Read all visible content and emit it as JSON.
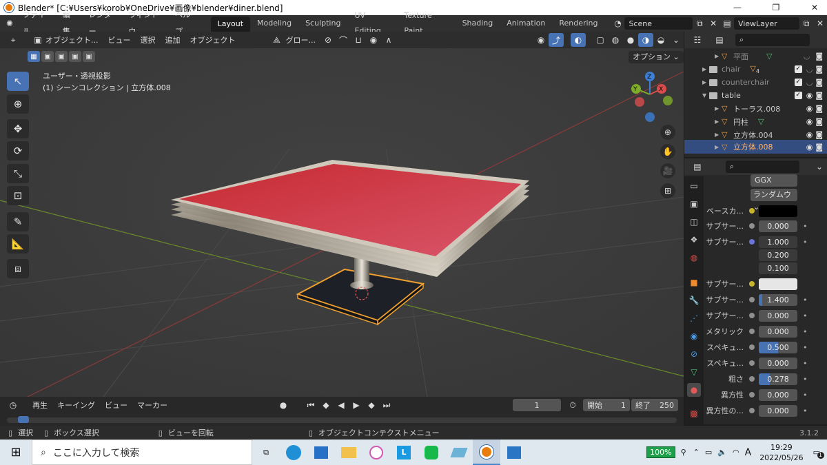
{
  "window": {
    "title": "Blender* [C:¥Users¥korob¥OneDrive¥画像¥blender¥diner.blend]"
  },
  "menubar": {
    "items": [
      "ファイル",
      "編集",
      "レンダー",
      "ウィンドウ",
      "ヘルプ"
    ],
    "workspaces": [
      "Layout",
      "Modeling",
      "Sculpting",
      "UV Editing",
      "Texture Paint",
      "Shading",
      "Animation",
      "Rendering"
    ],
    "active_workspace": "Layout",
    "scene": "Scene",
    "viewlayer": "ViewLayer"
  },
  "viewport": {
    "mode": "オブジェクト...",
    "menus": [
      "ビュー",
      "選択",
      "追加",
      "オブジェクト"
    ],
    "transform_orientation": "グロー...",
    "info_line1": "ユーザー・透視投影",
    "info_line2": "(1) シーンコレクション | 立方体.008",
    "options_label": "オプション",
    "gizmo": {
      "x": "X",
      "y": "Y",
      "z": "Z"
    }
  },
  "outliner": {
    "rows": [
      {
        "name": "平面",
        "kind": "object",
        "icon": "mesh-data-icon",
        "dim": true,
        "expanded": false
      },
      {
        "name": "chair",
        "kind": "collection",
        "badge": "4",
        "dim": true
      },
      {
        "name": "counterchair",
        "kind": "collection",
        "dim": true
      },
      {
        "name": "table",
        "kind": "collection",
        "dim": false
      },
      {
        "name": "トーラス.008",
        "kind": "object"
      },
      {
        "name": "円柱",
        "kind": "object"
      },
      {
        "name": "立方体.004",
        "kind": "object"
      },
      {
        "name": "立方体.008",
        "kind": "object",
        "selected": true
      }
    ]
  },
  "properties": {
    "dropdown1": "GGX",
    "dropdown2": "ランダムウ",
    "rows": [
      {
        "label": "ベースカ...",
        "type": "color",
        "color": "#000000",
        "dot": "yellow"
      },
      {
        "label": "サブサー...",
        "value": "0.000"
      },
      {
        "label": "サブサー...",
        "values": [
          "1.000",
          "0.200",
          "0.100"
        ],
        "dot": "blue"
      },
      {
        "label": "サブサー...",
        "type": "color",
        "color": "#e6e6e6",
        "dot": "yellow"
      },
      {
        "label": "サブサー...",
        "value": "1.400",
        "fill": 0.05
      },
      {
        "label": "サブサー...",
        "value": "0.000"
      },
      {
        "label": "メタリック",
        "value": "0.000"
      },
      {
        "label": "スペキュ...",
        "value": "0.500",
        "fill": 0.5
      },
      {
        "label": "スペキュ...",
        "value": "0.000"
      },
      {
        "label": "粗さ",
        "value": "0.278",
        "fill": 0.278
      },
      {
        "label": "異方性",
        "value": "0.000"
      },
      {
        "label": "異方性の...",
        "value": "0.000"
      }
    ]
  },
  "timeline": {
    "menus": [
      "再生",
      "キーイング",
      "ビュー",
      "マーカー"
    ],
    "current_frame": "1",
    "start_label": "開始",
    "start": "1",
    "end_label": "終了",
    "end": "250"
  },
  "statusbar": {
    "select": "選択",
    "box_select": "ボックス選択",
    "rotate": "ビューを回転",
    "context_menu": "オブジェクトコンテクストメニュー",
    "version": "3.1.2"
  },
  "taskbar": {
    "search_placeholder": "ここに入力して検索",
    "battery": "100%",
    "time": "19:29",
    "date": "2022/05/26",
    "ime": "A",
    "notifications": "1"
  },
  "colors": {
    "accent": "#4772b3",
    "table_top": "#d8383c",
    "selection_outline": "#f5a623"
  }
}
